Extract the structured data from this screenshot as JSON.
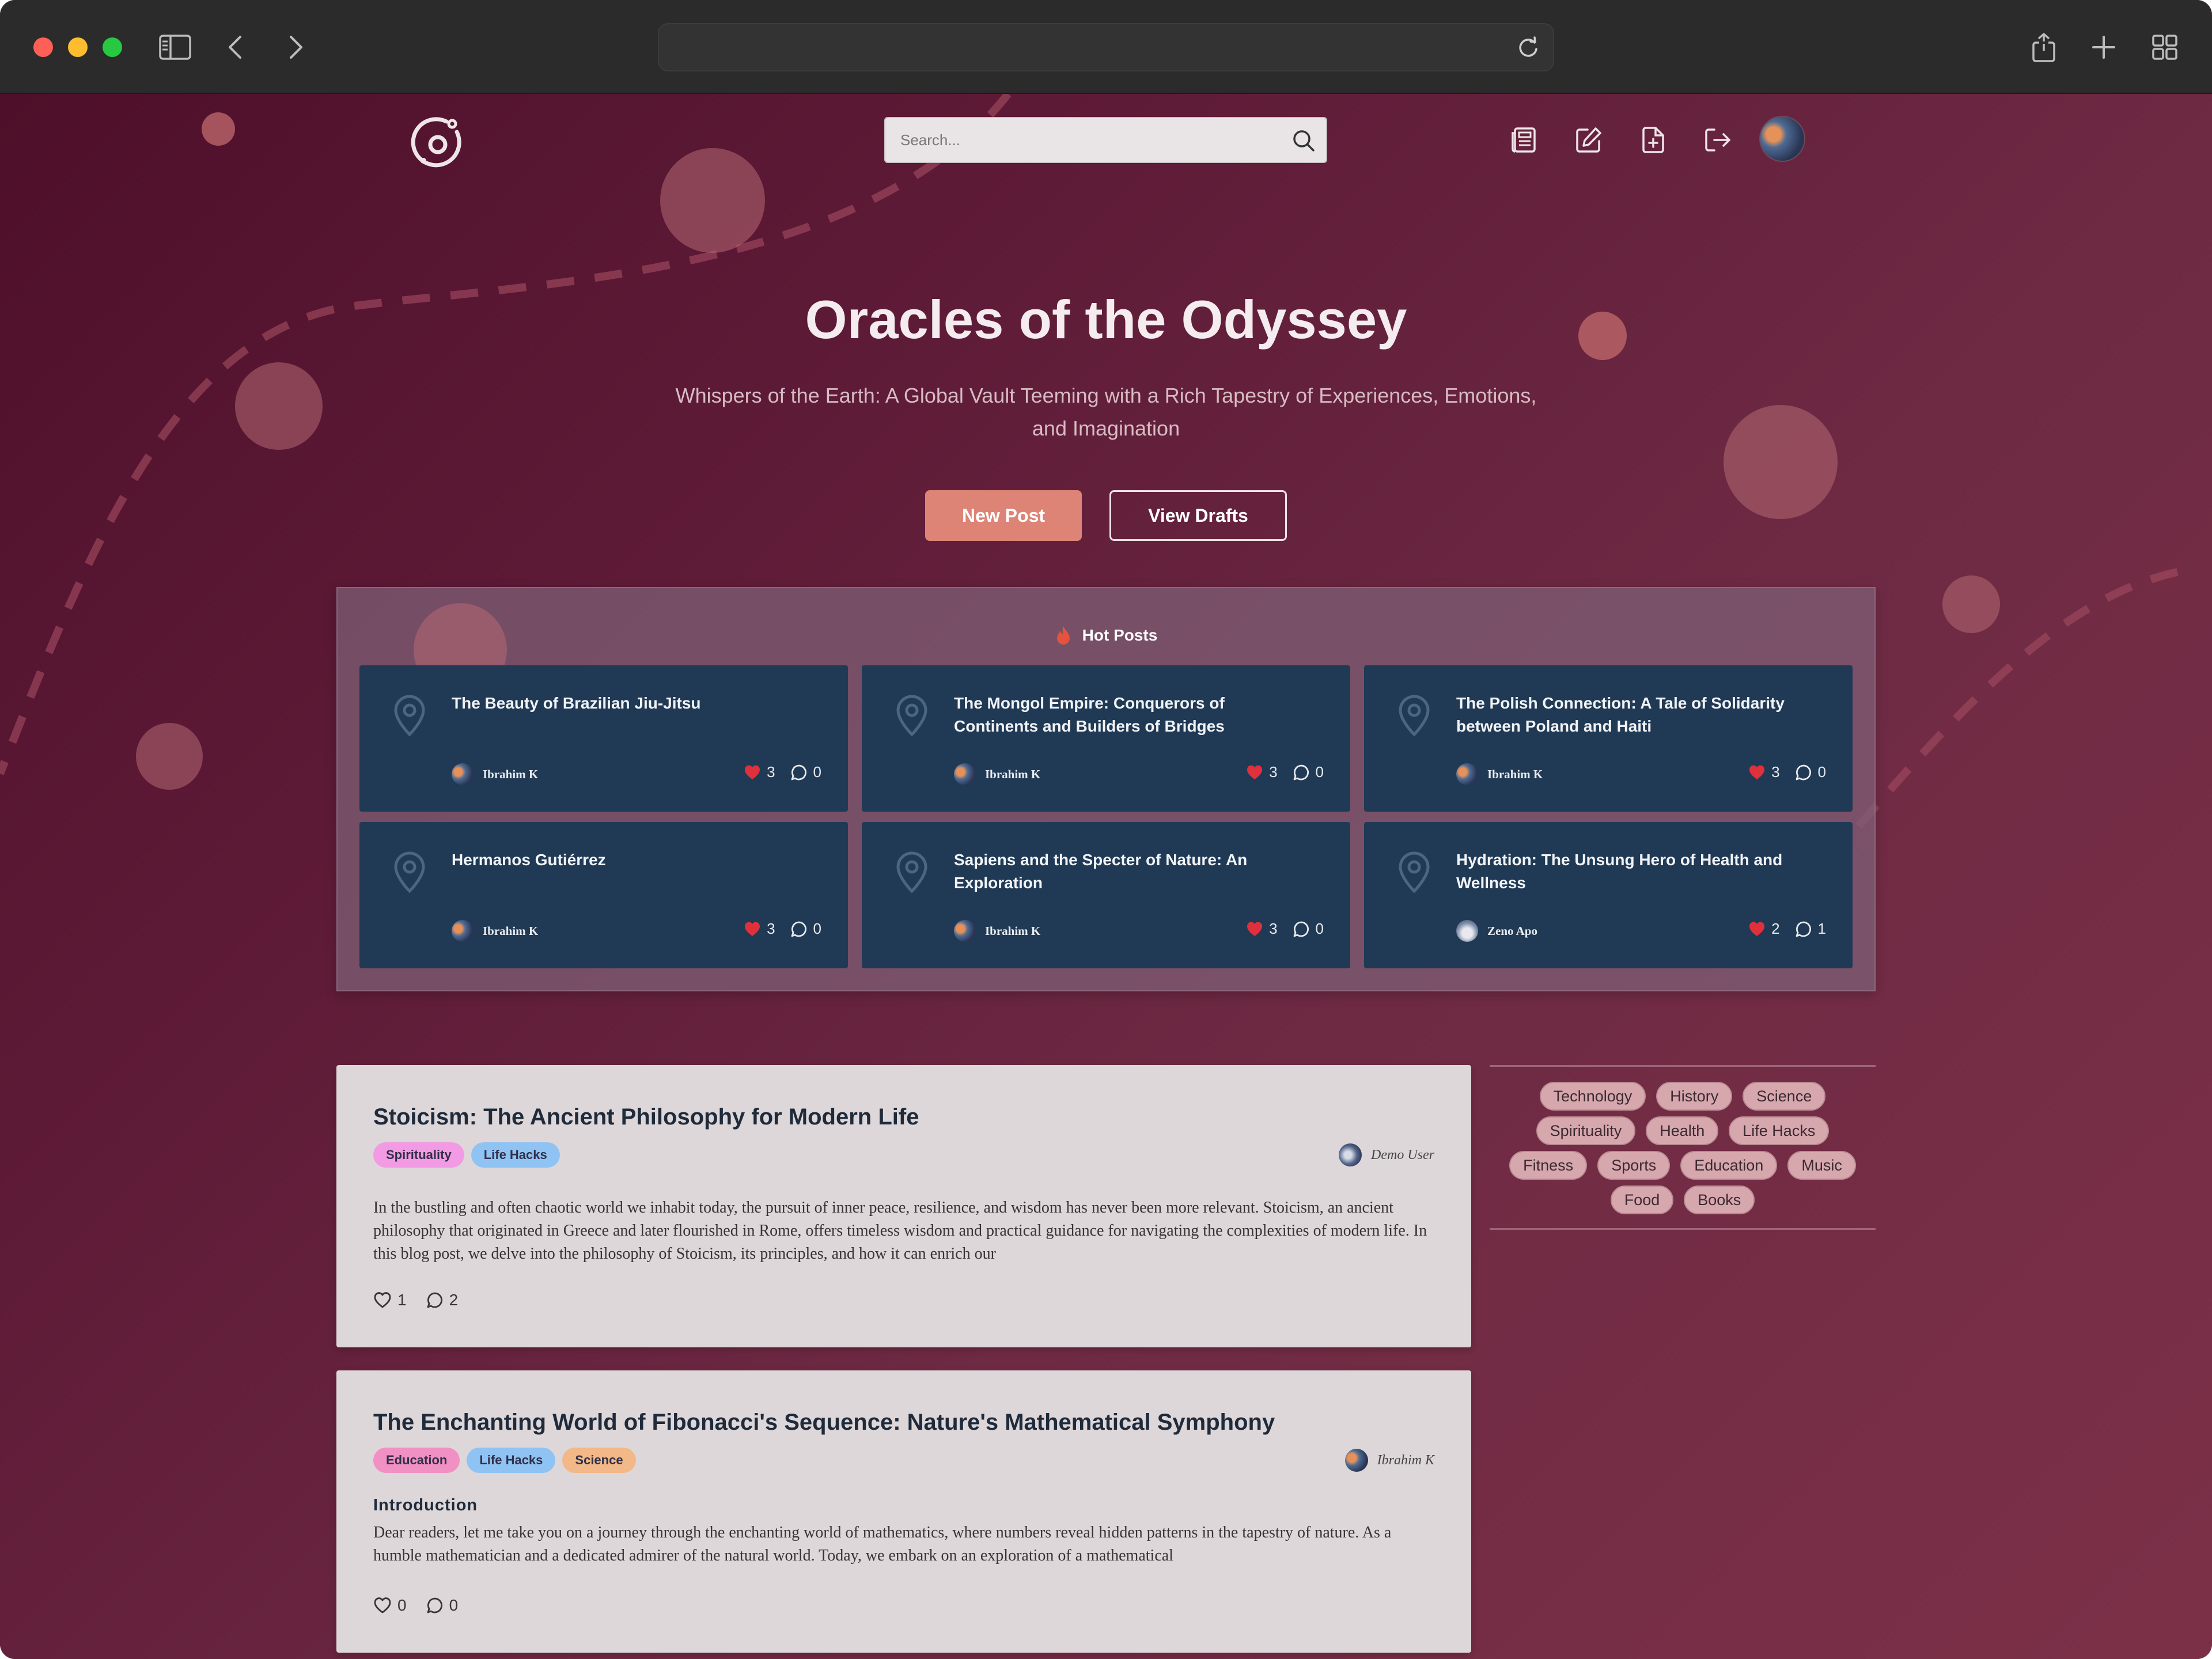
{
  "browser": {
    "url": "",
    "icons": [
      "sidebar-icon",
      "back-icon",
      "forward-icon",
      "reload-icon",
      "share-icon",
      "new-tab-icon",
      "tab-overview-icon"
    ]
  },
  "nav": {
    "search_placeholder": "Search...",
    "icons": [
      "posts-icon",
      "edit-icon",
      "new-file-icon",
      "logout-icon"
    ]
  },
  "hero": {
    "title": "Oracles of the Odyssey",
    "subtitle": "Whispers of the Earth: A Global Vault Teeming with a Rich Tapestry of Experiences, Emotions, and Imagination",
    "new_post_label": "New Post",
    "view_drafts_label": "View Drafts"
  },
  "hot": {
    "heading": "Hot Posts",
    "cards": [
      {
        "title": "The Beauty of Brazilian Jiu-Jitsu",
        "author": "Ibrahim K",
        "likes": "3",
        "comments": "0"
      },
      {
        "title": "The Mongol Empire: Conquerors of Continents and Builders of Bridges",
        "author": "Ibrahim K",
        "likes": "3",
        "comments": "0"
      },
      {
        "title": "The Polish Connection: A Tale of Solidarity between Poland and Haiti",
        "author": "Ibrahim K",
        "likes": "3",
        "comments": "0"
      },
      {
        "title": "Hermanos Gutiérrez",
        "author": "Ibrahim K",
        "likes": "3",
        "comments": "0"
      },
      {
        "title": "Sapiens and the Specter of Nature: An Exploration",
        "author": "Ibrahim K",
        "likes": "3",
        "comments": "0"
      },
      {
        "title": "Hydration: The Unsung Hero of Health and Wellness",
        "author": "Zeno Apo",
        "likes": "2",
        "comments": "1"
      }
    ]
  },
  "posts": [
    {
      "title": "Stoicism: The Ancient Philosophy for Modern Life",
      "tags": [
        "Spirituality",
        "Life Hacks"
      ],
      "author": "Demo User",
      "excerpt": "In the bustling and often chaotic world we inhabit today, the pursuit of inner peace, resilience, and wisdom has never been more relevant. Stoicism, an ancient philosophy that originated in Greece and later flourished in Rome, offers timeless wisdom and practical guidance for navigating the complexities of modern life. In this blog post, we delve into the philosophy of Stoicism, its principles, and how it can enrich our",
      "likes": "1",
      "comments": "2"
    },
    {
      "title": "The Enchanting World of Fibonacci's Sequence: Nature's Mathematical Symphony",
      "tags": [
        "Education",
        "Life Hacks",
        "Science"
      ],
      "author": "Ibrahim K",
      "subhead": "Introduction",
      "excerpt": "Dear readers, let me take you on a journey through the enchanting world of mathematics, where numbers reveal hidden patterns in the tapestry of nature. As a humble mathematician and a dedicated admirer of the natural world. Today, we embark on an exploration of a mathematical",
      "likes": "0",
      "comments": "0"
    }
  ],
  "categories": {
    "rows": [
      [
        "Technology",
        "History",
        "Science"
      ],
      [
        "Spirituality",
        "Health",
        "Life Hacks"
      ],
      [
        "Fitness",
        "Sports",
        "Education",
        "Music"
      ],
      [
        "Food",
        "Books"
      ]
    ]
  },
  "colors": {
    "accent": "#dd8476",
    "hot_card": "#203a55",
    "background": "#5d1a34"
  }
}
